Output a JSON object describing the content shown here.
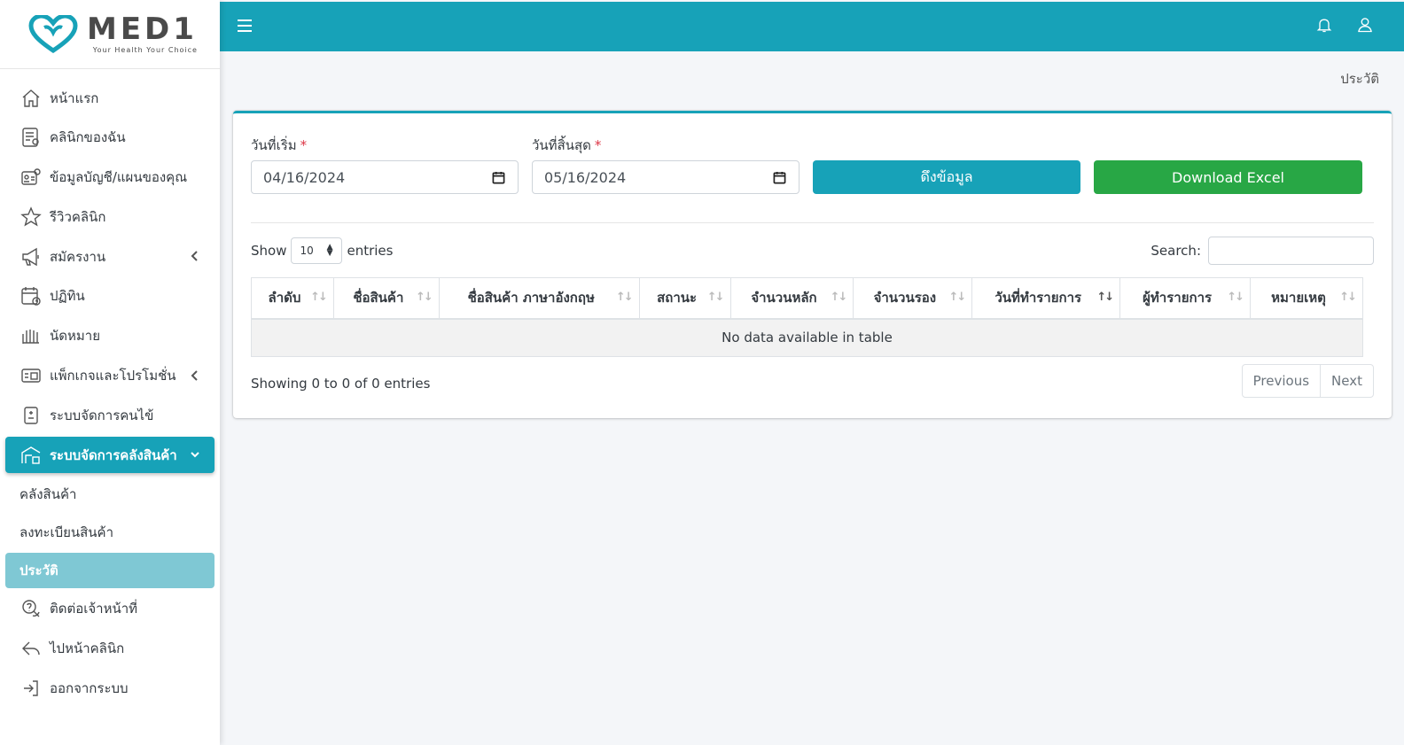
{
  "brand": {
    "name": "MED1",
    "tagline": "Your Health Your Choice",
    "color": "#17a2b8"
  },
  "sidebar": {
    "items": [
      {
        "label": "หน้าแรก",
        "icon": "home-icon"
      },
      {
        "label": "คลินิกของฉัน",
        "icon": "clinic-list-icon"
      },
      {
        "label": "ข้อมูลบัญชี/แผนของคุณ",
        "icon": "account-card-icon"
      },
      {
        "label": "รีวิวคลินิก",
        "icon": "star-icon"
      },
      {
        "label": "สมัครงาน",
        "icon": "megaphone-icon",
        "expandable": true
      },
      {
        "label": "ปฏิทิน",
        "icon": "calendar-icon"
      },
      {
        "label": "นัดหมาย",
        "icon": "appointment-icon"
      },
      {
        "label": "แพ็กเกจและโปรโมชั่น",
        "icon": "package-icon",
        "expandable": true
      },
      {
        "label": "ระบบจัดการคนไข้",
        "icon": "patient-icon"
      },
      {
        "label": "ระบบจัดการคลังสินค้า",
        "icon": "warehouse-icon",
        "expandable": true,
        "active": true
      }
    ],
    "subitems": [
      {
        "label": "คลังสินค้า"
      },
      {
        "label": "ลงทะเบียนสินค้า"
      },
      {
        "label": "ประวัติ",
        "current": true
      }
    ],
    "bottom_items": [
      {
        "label": "ติดต่อเจ้าหน้าที่",
        "icon": "contact-chat-icon"
      },
      {
        "label": "ไปหน้าคลินิก",
        "icon": "reply-arrow-icon"
      },
      {
        "label": "ออกจากระบบ",
        "icon": "logout-icon"
      }
    ]
  },
  "topbar": {
    "menu_icon": "hamburger-icon",
    "bell_icon": "bell-icon",
    "user_icon": "user-icon"
  },
  "breadcrumb": "ประวัติ",
  "filters": {
    "start_label": "วันที่เริ่ม",
    "end_label": "วันที่สิ้นสุด",
    "required_mark": "*",
    "start_value": "04/16/2024",
    "end_value": "05/16/2024",
    "fetch_button": "ดึงข้อมูล",
    "excel_button": "Download Excel"
  },
  "table_controls": {
    "show_label": "Show",
    "page_length": "10",
    "entries_label": "entries",
    "search_label": "Search:"
  },
  "table": {
    "columns": [
      "ลำดับ",
      "ชื่อสินค้า",
      "ชื่อสินค้า ภาษาอังกฤษ",
      "สถานะ",
      "จำนวนหลัก",
      "จำนวนรอง",
      "วันที่ทำรายการ",
      "ผู้ทำรายการ",
      "หมายเหตุ"
    ],
    "empty_message": "No data available in table"
  },
  "footer": {
    "info": "Showing 0 to 0 of 0 entries",
    "previous": "Previous",
    "next": "Next"
  },
  "colors": {
    "primary": "#17a2b8",
    "success": "#28a745",
    "submenu_current": "#7fc8d4"
  }
}
